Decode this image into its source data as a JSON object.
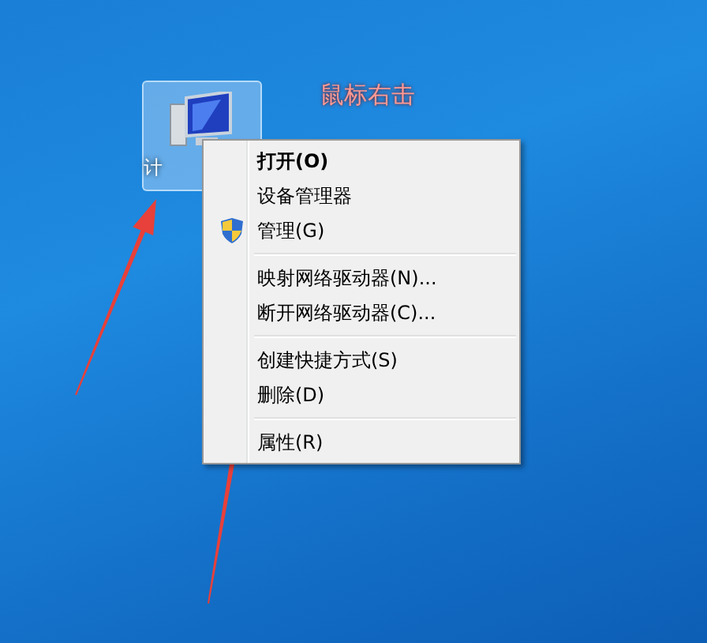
{
  "desktop": {
    "icons": [
      {
        "label": "计",
        "selected": true
      }
    ],
    "annotation": "鼠标右击"
  },
  "context_menu": {
    "items": [
      {
        "kind": "command",
        "label": "打开(O)",
        "default": true
      },
      {
        "kind": "command",
        "label": "设备管理器",
        "default": false
      },
      {
        "kind": "admin_command",
        "label": "管理(G)",
        "default": false
      },
      {
        "kind": "separator"
      },
      {
        "kind": "command",
        "label": "映射网络驱动器(N)...",
        "default": false
      },
      {
        "kind": "command",
        "label": "断开网络驱动器(C)...",
        "default": false
      },
      {
        "kind": "separator"
      },
      {
        "kind": "command",
        "label": "创建快捷方式(S)",
        "default": false
      },
      {
        "kind": "command",
        "label": "删除(D)",
        "default": false
      },
      {
        "kind": "separator"
      },
      {
        "kind": "command",
        "label": "属性(R)",
        "default": false
      }
    ]
  }
}
